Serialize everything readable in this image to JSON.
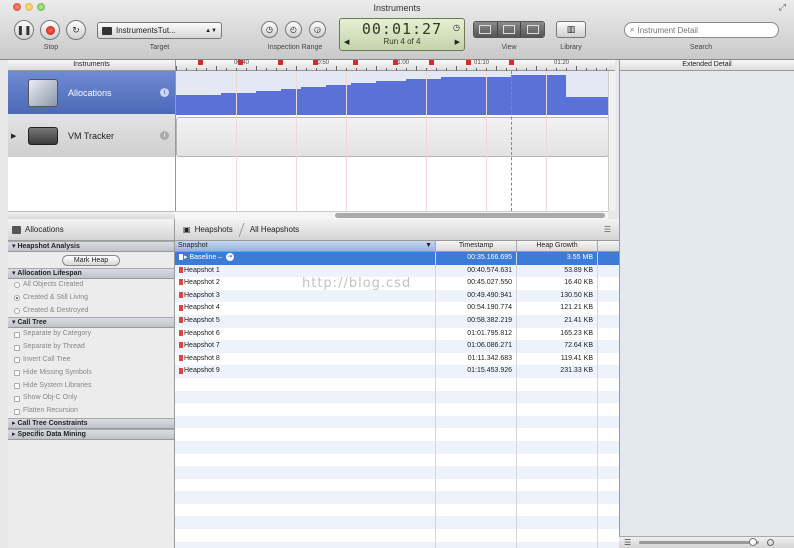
{
  "window": {
    "title": "Instruments"
  },
  "toolbar": {
    "stop_label": "Stop",
    "target_label": "Target",
    "target_value": "InstrumentsTut...",
    "inspection_label": "Inspection Range",
    "timer": "00:01:27",
    "run": "Run 4 of 4",
    "view_label": "View",
    "library_label": "Library",
    "search_placeholder": "Instrument Detail",
    "search_label": "Search"
  },
  "headers": {
    "instruments": "Instruments",
    "extended_detail": "Extended Detail"
  },
  "ruler": {
    "labels": [
      "00:40",
      "00:50",
      "01:00",
      "01:10",
      "01:20"
    ]
  },
  "instruments": [
    {
      "name": "Allocations",
      "selected": true
    },
    {
      "name": "VM Tracker",
      "selected": false
    }
  ],
  "left_panel": {
    "title": "Allocations",
    "heapshot_section": "Heapshot Analysis",
    "mark_heap": "Mark Heap",
    "lifespan_section": "Allocation Lifespan",
    "lifespan_options": [
      "All Objects Created",
      "Created & Still Living",
      "Created & Destroyed"
    ],
    "calltree_section": "Call Tree",
    "calltree_options": [
      "Separate by Category",
      "Separate by Thread",
      "Invert Call Tree",
      "Hide Missing Symbols",
      "Hide System Libraries",
      "Show Obj-C Only",
      "Flatten Recursion"
    ],
    "constraints_section": "Call Tree Constraints",
    "datamining_section": "Specific Data Mining"
  },
  "breadcrumb": {
    "items": [
      "Heapshots",
      "All Heapshots"
    ]
  },
  "table": {
    "columns": [
      "Snapshot",
      "Timestamp",
      "Heap Growth"
    ],
    "rows": [
      {
        "snapshot": "Baseline",
        "timestamp": "00:35.166.695",
        "growth": "3.55 MB"
      },
      {
        "snapshot": "Heapshot 1",
        "timestamp": "00:40.574.631",
        "growth": "53.89 KB"
      },
      {
        "snapshot": "Heapshot 2",
        "timestamp": "00:45.027.550",
        "growth": "16.40 KB"
      },
      {
        "snapshot": "Heapshot 3",
        "timestamp": "00:49.490.941",
        "growth": "130.50 KB"
      },
      {
        "snapshot": "Heapshot 4",
        "timestamp": "00:54.190.774",
        "growth": "121.21 KB"
      },
      {
        "snapshot": "Heapshot 5",
        "timestamp": "00:58.382.219",
        "growth": "21.41 KB"
      },
      {
        "snapshot": "Heapshot 6",
        "timestamp": "01:01.795.812",
        "growth": "165.23 KB"
      },
      {
        "snapshot": "Heapshot 7",
        "timestamp": "01:06.086.271",
        "growth": "72.64 KB"
      },
      {
        "snapshot": "Heapshot 8",
        "timestamp": "01:11.342.683",
        "growth": "119.41 KB"
      },
      {
        "snapshot": "Heapshot 9",
        "timestamp": "01:15.453.926",
        "growth": "231.33 KB"
      }
    ]
  },
  "watermark": "http://blog.csd",
  "colors": {
    "selection": "#3d7cd6",
    "track_fill": "#5a72d8",
    "instrument_selected": "#5b78c4"
  }
}
